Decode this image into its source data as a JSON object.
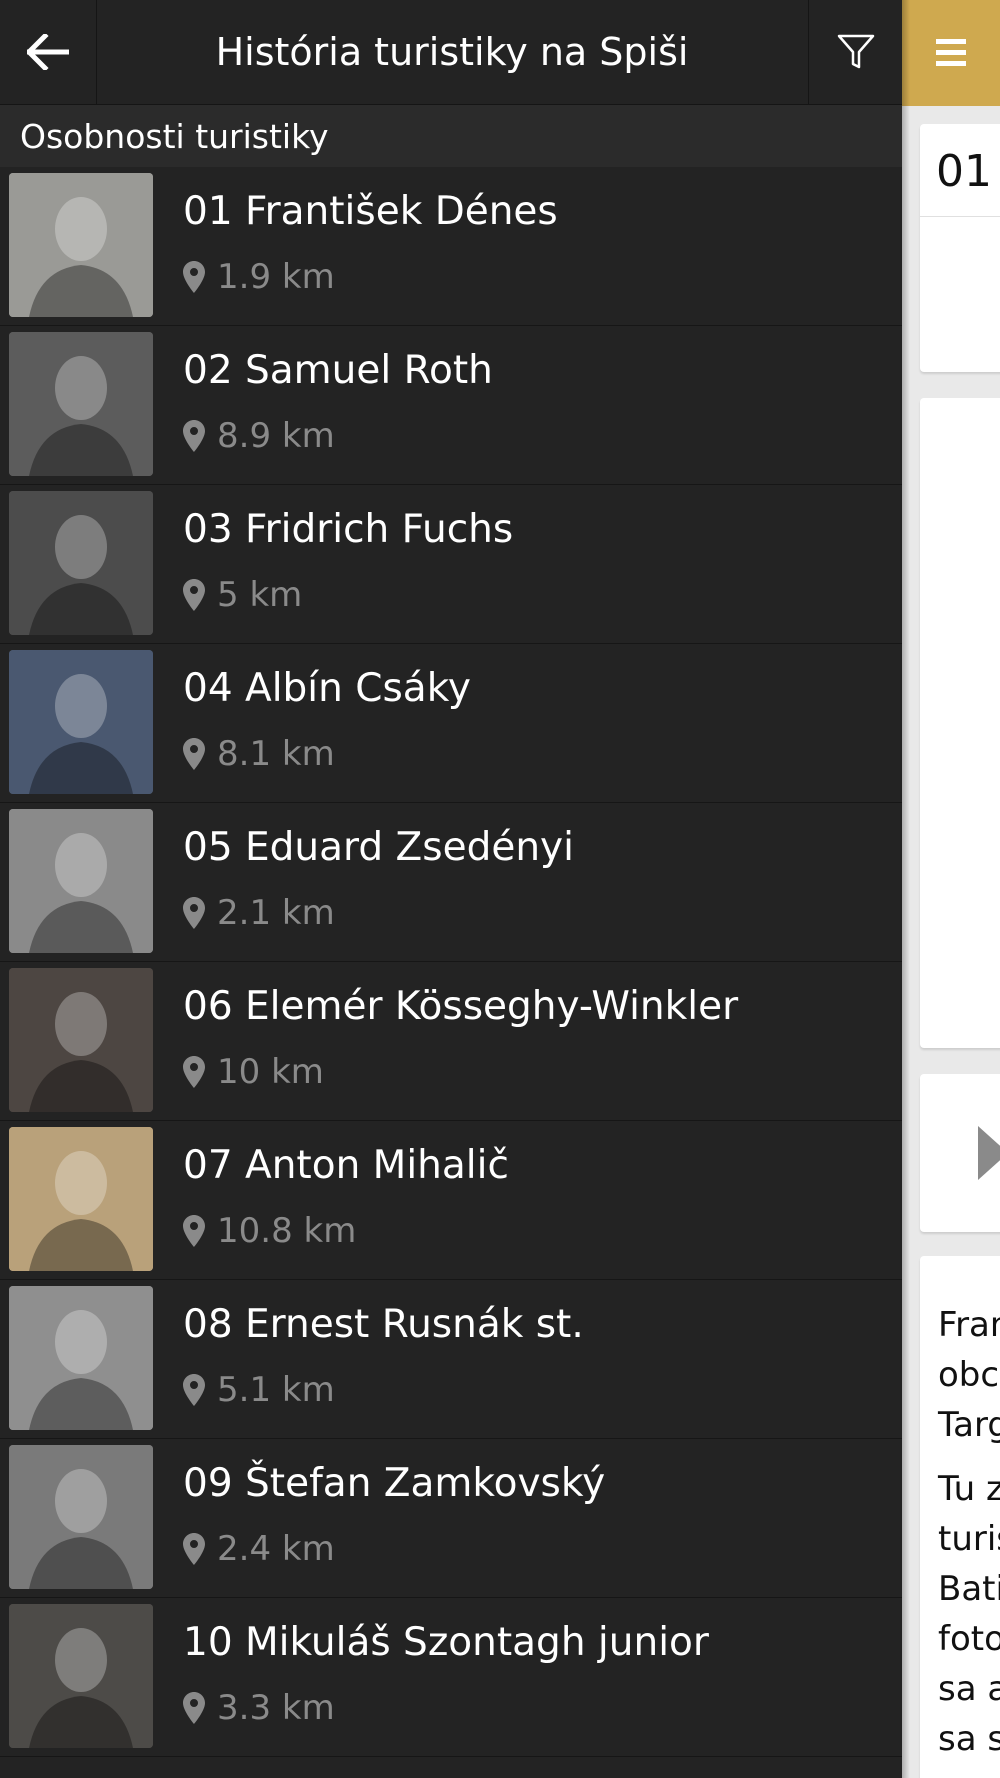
{
  "header": {
    "title": "História turistiky na Spiši",
    "back_icon": "arrow-left-icon",
    "filter_icon": "filter-icon",
    "menu_icon": "hamburger-menu-icon"
  },
  "section": {
    "title": "Osobnosti turistiky"
  },
  "colors": {
    "accent": "#cfa94f",
    "drawer_bg": "#232323",
    "section_bg": "#2b2b2b",
    "distance_text": "#8a8a8a"
  },
  "items": [
    {
      "title": "01 František Dénes",
      "distance": "1.9 km",
      "tone": "#9a9a96"
    },
    {
      "title": "02 Samuel Roth",
      "distance": "8.9 km",
      "tone": "#5c5c5c"
    },
    {
      "title": "03 Fridrich Fuchs",
      "distance": "5 km",
      "tone": "#4c4c4c"
    },
    {
      "title": "04 Albín Csáky",
      "distance": "8.1 km",
      "tone": "#4a5870"
    },
    {
      "title": "05 Eduard Zsedényi",
      "distance": "2.1 km",
      "tone": "#8a8a8a"
    },
    {
      "title": "06 Elemér Kösseghy-Winkler",
      "distance": "10 km",
      "tone": "#4d4642"
    },
    {
      "title": "07 Anton Mihalič",
      "distance": "10.8 km",
      "tone": "#b9a17a"
    },
    {
      "title": "08 Ernest Rusnák st.",
      "distance": "5.1 km",
      "tone": "#8f8f8f"
    },
    {
      "title": "09 Štefan Zamkovský",
      "distance": "2.4 km",
      "tone": "#7a7a7a"
    },
    {
      "title": "10 Mikuláš Szontagh junior",
      "distance": "3.3 km",
      "tone": "#4d4b48"
    }
  ],
  "main": {
    "card_number": "01",
    "body_lines_1": [
      "Fran",
      "obc",
      "Targ"
    ],
    "body_lines_2": [
      "Tu z",
      "turis",
      "Bati",
      "foto",
      "sa a",
      "sa s"
    ]
  }
}
